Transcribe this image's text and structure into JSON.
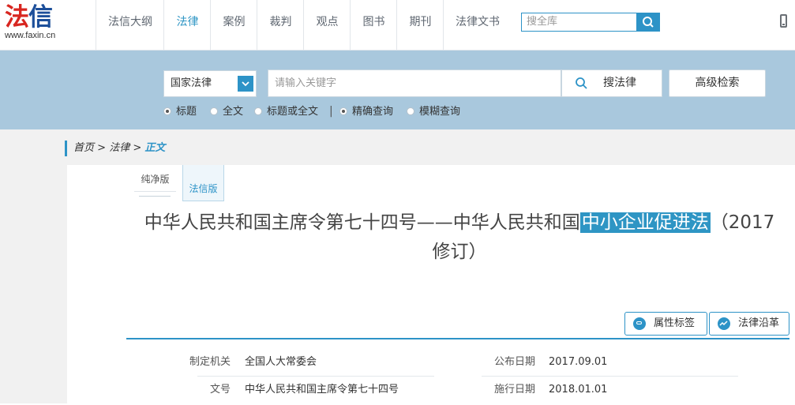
{
  "logo": {
    "brand_a": "法",
    "brand_b": "信",
    "url": "www.faxin.cn"
  },
  "nav": {
    "items": [
      "法信大纲",
      "法律",
      "案例",
      "裁判",
      "观点",
      "图书",
      "期刊",
      "法律文书"
    ],
    "active_index": 1,
    "search_placeholder": "搜全库"
  },
  "search": {
    "scope": "国家法律",
    "keyword_placeholder": "请输入关键字",
    "search_button": "搜法律",
    "advanced_button": "高级检索",
    "radios": [
      {
        "label": "标题",
        "checked": true
      },
      {
        "label": "全文",
        "checked": false
      },
      {
        "label": "标题或全文",
        "checked": false
      },
      {
        "label": "精确查询",
        "checked": true
      },
      {
        "label": "模糊查询",
        "checked": false
      }
    ],
    "divider": "|"
  },
  "breadcrumb": {
    "home": "首页",
    "sep1": " > ",
    "section": "法律",
    "sep2": " > ",
    "current": "正文"
  },
  "tabs": {
    "pure": "纯净版",
    "faxin": "法信版"
  },
  "document": {
    "title_before": "中华人民共和国主席令第七十四号——中华人民共和国",
    "title_highlight": "中小企业促进法",
    "title_after": "（2017",
    "title_line2": "修订）"
  },
  "actions": {
    "tags": "属性标签",
    "history": "法律沿革"
  },
  "meta": {
    "issuer_label": "制定机关",
    "issuer": "全国人大常委会",
    "publish_label": "公布日期",
    "publish_date": "2017.09.01",
    "docno_label": "文号",
    "docno": "中华人民共和国主席令第七十四号",
    "effective_label": "施行日期",
    "effective_date": "2018.01.01"
  },
  "colors": {
    "accent": "#2d93c7",
    "band": "#a9c8dd",
    "logo_red": "#d82620",
    "logo_blue": "#1d4f9a"
  }
}
